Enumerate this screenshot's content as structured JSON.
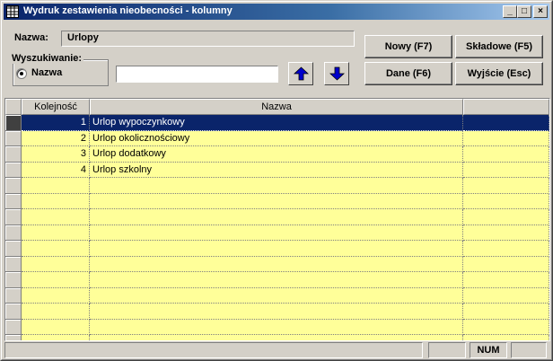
{
  "window": {
    "title": "Wydruk zestawienia nieobecności - kolumny",
    "minimize": "_",
    "maximize": "□",
    "close": "×"
  },
  "form": {
    "nazwa_label": "Nazwa:",
    "nazwa_value": "Urlopy",
    "search_group_label": "Wyszukiwanie:",
    "search_option_label": "Nazwa",
    "search_value": ""
  },
  "buttons": {
    "nowy": "Nowy (F7)",
    "skladowe": "Składowe (F5)",
    "dane": "Dane (F6)",
    "wyjscie": "Wyjście (Esc)"
  },
  "grid": {
    "columns": [
      "Kolejność",
      "Nazwa",
      ""
    ],
    "rows": [
      {
        "order": "1",
        "name": "Urlop wypoczynkowy",
        "selected": true
      },
      {
        "order": "2",
        "name": "Urlop okolicznościowy",
        "selected": false
      },
      {
        "order": "3",
        "name": "Urlop dodatkowy",
        "selected": false
      },
      {
        "order": "4",
        "name": "Urlop szkolny",
        "selected": false
      }
    ],
    "empty_row_count": 11
  },
  "status": {
    "panel1": "",
    "panel2": "",
    "num": "NUM",
    "panel4": ""
  },
  "colors": {
    "title_active": "#0a246a",
    "row_fill": "#ffff99",
    "row_selected": "#0a246a",
    "arrow_blue": "#0000cc"
  }
}
